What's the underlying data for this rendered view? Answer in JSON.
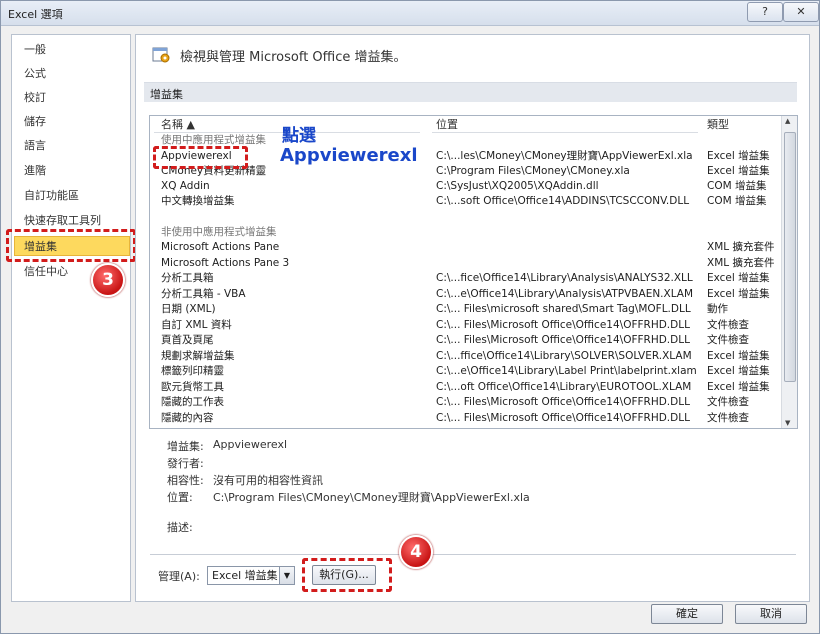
{
  "window": {
    "title": "Excel 選項",
    "help_label": "?",
    "close_label": "✕"
  },
  "sidebar": {
    "items": [
      "一般",
      "公式",
      "校訂",
      "儲存",
      "語言",
      "進階",
      "自訂功能區",
      "快速存取工具列",
      "增益集",
      "信任中心"
    ],
    "selected": "增益集"
  },
  "header": {
    "text": "檢視與管理 Microsoft Office 增益集。"
  },
  "section": {
    "title": "增益集"
  },
  "table": {
    "columns": [
      "名稱 ▲",
      "位置",
      "類型"
    ],
    "groups": [
      {
        "label": "使用中應用程式增益集",
        "rows": [
          [
            "Appviewerexl",
            "C:\\...les\\CMoney\\CMoney理財寶\\AppViewerExl.xla",
            "Excel 增益集"
          ],
          [
            "CMoney資料更新精靈",
            "C:\\Program Files\\CMoney\\CMoney.xla",
            "Excel 增益集"
          ],
          [
            "XQ Addin",
            "C:\\SysJust\\XQ2005\\XQAddin.dll",
            "COM 增益集"
          ],
          [
            "中文轉換增益集",
            "C:\\...soft Office\\Office14\\ADDINS\\TCSCCONV.DLL",
            "COM 增益集"
          ]
        ]
      },
      {
        "label": "非使用中應用程式增益集",
        "rows": [
          [
            "Microsoft Actions Pane",
            "",
            "XML 擴充套件"
          ],
          [
            "Microsoft Actions Pane 3",
            "",
            "XML 擴充套件"
          ],
          [
            "分析工具箱",
            "C:\\...fice\\Office14\\Library\\Analysis\\ANALYS32.XLL",
            "Excel 增益集"
          ],
          [
            "分析工具箱 - VBA",
            "C:\\...e\\Office14\\Library\\Analysis\\ATPVBAEN.XLAM",
            "Excel 增益集"
          ],
          [
            "日期 (XML)",
            "C:\\... Files\\microsoft shared\\Smart Tag\\MOFL.DLL",
            "動作"
          ],
          [
            "自訂 XML 資料",
            "C:\\... Files\\Microsoft Office\\Office14\\OFFRHD.DLL",
            "文件檢查"
          ],
          [
            "頁首及頁尾",
            "C:\\... Files\\Microsoft Office\\Office14\\OFFRHD.DLL",
            "文件檢查"
          ],
          [
            "規劃求解增益集",
            "C:\\...ffice\\Office14\\Library\\SOLVER\\SOLVER.XLAM",
            "Excel 增益集"
          ],
          [
            "標籤列印精靈",
            "C:\\...e\\Office14\\Library\\Label Print\\labelprint.xlam",
            "Excel 增益集"
          ],
          [
            "歐元貨幣工具",
            "C:\\...oft Office\\Office14\\Library\\EUROTOOL.XLAM",
            "Excel 增益集"
          ],
          [
            "隱藏的工作表",
            "C:\\... Files\\Microsoft Office\\Office14\\OFFRHD.DLL",
            "文件檢查"
          ],
          [
            "隱藏的內容",
            "C:\\... Files\\Microsoft Office\\Office14\\OFFRHD.DLL",
            "文件檢查"
          ]
        ]
      }
    ]
  },
  "annotations": {
    "click_label": "點選",
    "target_label": "Appviewerexl",
    "badge3": "3",
    "badge4": "4"
  },
  "details": {
    "addin_label": "增益集:",
    "addin_value": "Appviewerexl",
    "publisher_label": "發行者:",
    "publisher_value": "",
    "compat_label": "相容性:",
    "compat_value": "沒有可用的相容性資訊",
    "location_label": "位置:",
    "location_value": "C:\\Program Files\\CMoney\\CMoney理財寶\\AppViewerExl.xla",
    "desc_label": "描述:"
  },
  "manage": {
    "label": "管理(A):",
    "select_value": "Excel 增益集",
    "go_label": "執行(G)..."
  },
  "footer": {
    "ok_label": "確定",
    "cancel_label": "取消"
  }
}
